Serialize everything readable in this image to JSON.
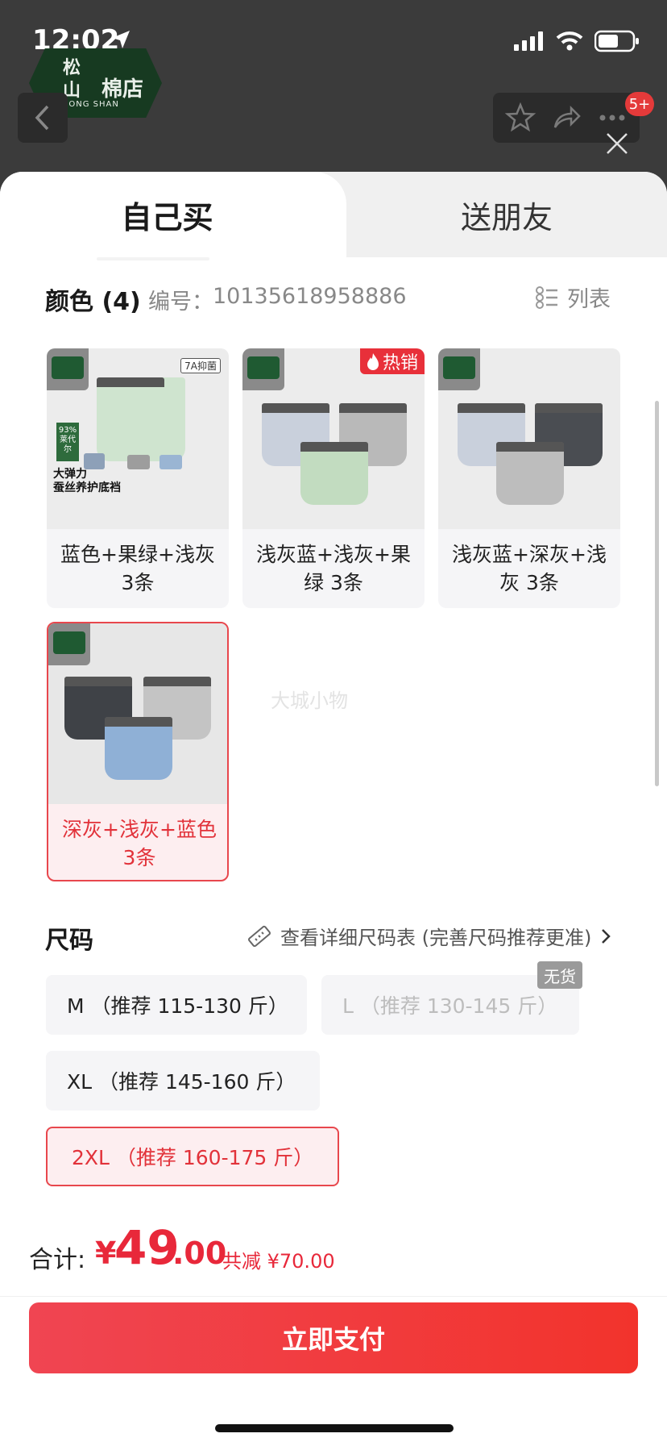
{
  "status_bar": {
    "time": "12:02"
  },
  "store": {
    "logo_line1": "松",
    "logo_line2": "山",
    "logo_name": "棉店",
    "logo_en": "SONG SHAN"
  },
  "header": {
    "notification_badge": "5+"
  },
  "tabs": [
    {
      "label": "自己买"
    },
    {
      "label": "送朋友"
    }
  ],
  "color_section": {
    "title": "颜色 (4)",
    "sku_label": "编号：",
    "sku": "10135618958886",
    "list_label": "列表",
    "hot_badge": "热销",
    "card1_tag": "7A抑菌",
    "card1_pct": "93%",
    "card1_pct_label": "莱代尔",
    "card1_caption1": "大弹力",
    "card1_caption2": "蚕丝养护底裆",
    "options": [
      {
        "label": "蓝色+果绿+浅灰 3条"
      },
      {
        "label": "浅灰蓝+浅灰+果绿 3条"
      },
      {
        "label": "浅灰蓝+深灰+浅灰 3条"
      },
      {
        "label": "深灰+浅灰+蓝色 3条"
      }
    ],
    "selected_index": 3,
    "watermark": "大城小物"
  },
  "size_section": {
    "title": "尺码",
    "chart_link": "查看详细尺码表 (完善尺码推荐更准)",
    "out_of_stock": "无货",
    "options": [
      {
        "label": "M （推荐 115-130 斤）"
      },
      {
        "label": "L （推荐 130-145 斤）"
      },
      {
        "label": "XL （推荐 145-160 斤）"
      },
      {
        "label": "2XL （推荐 160-175 斤）"
      }
    ]
  },
  "footer": {
    "total_label": "合计:",
    "currency": "¥",
    "price_int": "49",
    "price_dec": ".00",
    "discount": "共减 ¥70.00",
    "pay_label": "立即支付"
  },
  "colors": {
    "accent": "#E8283A",
    "selected_bg": "#FDEEF0",
    "store_green": "#173A21"
  }
}
